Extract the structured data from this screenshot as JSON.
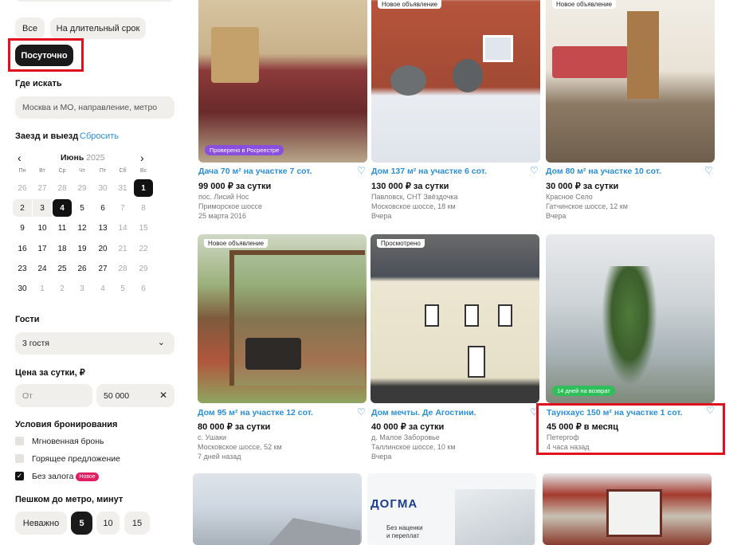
{
  "filters": {
    "rent_tabs": [
      "Все",
      "На длительный срок",
      "Посуточно"
    ],
    "where_label": "Где искать",
    "where_placeholder": "Москва и МО, направление, метро",
    "dates_label": "Заезд и выезд",
    "reset_label": "Сбросить",
    "month": "Июнь",
    "year": "2025",
    "weekdays": [
      "Пн",
      "Вт",
      "Ср",
      "Чт",
      "Пт",
      "Сб",
      "Вс"
    ],
    "calendar_rows": [
      [
        "26",
        "27",
        "28",
        "29",
        "30",
        "31",
        "1"
      ],
      [
        "2",
        "3",
        "4",
        "5",
        "6",
        "7",
        "8"
      ],
      [
        "9",
        "10",
        "11",
        "12",
        "13",
        "14",
        "15"
      ],
      [
        "16",
        "17",
        "18",
        "19",
        "20",
        "21",
        "22"
      ],
      [
        "23",
        "24",
        "25",
        "26",
        "27",
        "28",
        "29"
      ],
      [
        "30",
        "1",
        "2",
        "3",
        "4",
        "5",
        "6"
      ]
    ],
    "guests_label": "Гости",
    "guests_value": "3 гостя",
    "price_label": "Цена за сутки, ₽",
    "price_from_placeholder": "От",
    "price_to_value": "50 000",
    "booking_label": "Условия бронирования",
    "booking_options": [
      "Мгновенная бронь",
      "Горящее предложение",
      "Без залога"
    ],
    "new_badge": "Новое",
    "metro_label": "Пешком до метро, минут",
    "metro_options": [
      "Неважно",
      "5",
      "10",
      "15"
    ]
  },
  "listings": [
    {
      "title": "Дача 70 м² на участке 7 сот.",
      "price": "99 000 ₽ за сутки",
      "line1": "пос. Лисий Нос",
      "line2": "Приморское шоссе",
      "line3": "25 марта 2016",
      "tag": "",
      "badge": "Проверено в Росреестре"
    },
    {
      "title": "Дом 137 м² на участке 6 сот.",
      "price": "130 000 ₽ за сутки",
      "line1": "Павловск, СНТ Звёздочка",
      "line2": "Московское шоссе, 18 км",
      "line3": "Вчера",
      "tag": "Новое объявление",
      "badge": ""
    },
    {
      "title": "Дом 80 м² на участке 10 сот.",
      "price": "30 000 ₽ за сутки",
      "line1": "Красное Село",
      "line2": "Гатчинское шоссе, 12 км",
      "line3": "Вчера",
      "tag": "Новое объявление",
      "badge": ""
    },
    {
      "title": "Дом 95 м² на участке 12 сот.",
      "price": "80 000 ₽ за сутки",
      "line1": "с. Ушаки",
      "line2": "Московское шоссе, 52 км",
      "line3": "7 дней назад",
      "tag": "Новое объявление",
      "badge": ""
    },
    {
      "title": "Дом мечты. Де Агостини.",
      "price": "40 000 ₽ за сутки",
      "line1": "д. Малое Заборовье",
      "line2": "Таллинское шоссе, 10 км",
      "line3": "Вчера",
      "tag": "Просмотрено",
      "badge": ""
    },
    {
      "title": "Таунхаус 150 м² на участке 1 сот.",
      "price": "45 000 ₽ в месяц",
      "line1": "Петергоф",
      "line2": "4 часа назад",
      "line3": "",
      "tag": "",
      "badge": "14 дней на возврат"
    }
  ],
  "ad": {
    "brand": "ДОГМА",
    "line1": "Без наценки",
    "line2": "и переплат"
  },
  "colors": {
    "accent": "#2a8fd6",
    "highlight": "#e0101e",
    "dark": "#1a1a1a",
    "badge_purple": "#8b4fe0",
    "badge_green": "#2fbf5a"
  }
}
